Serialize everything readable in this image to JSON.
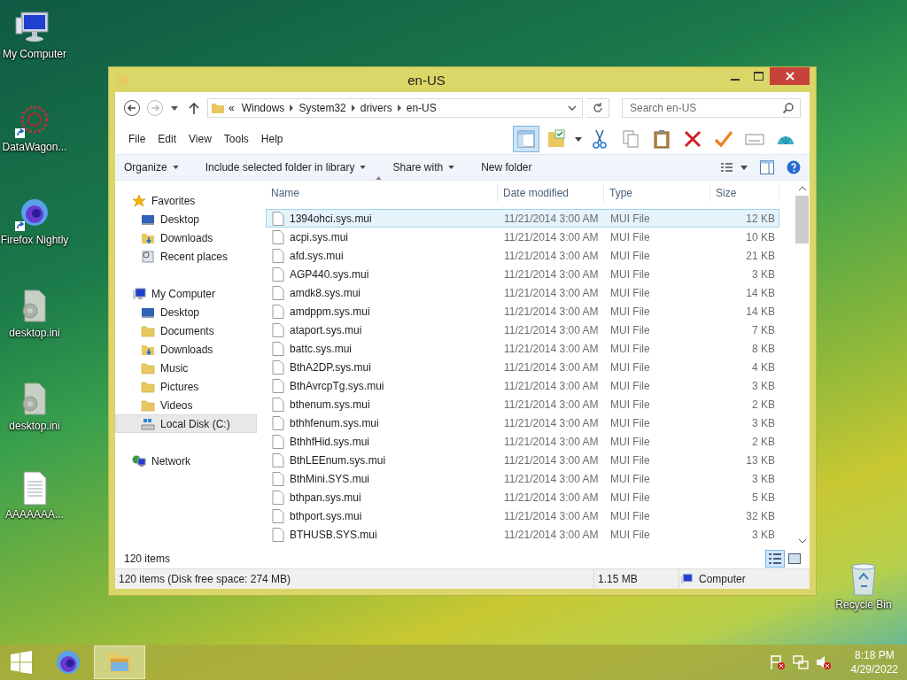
{
  "desktop_icons": [
    {
      "label": "My Computer",
      "kind": "computer",
      "shortcut": false
    },
    {
      "label": "DataWagon...",
      "kind": "wheel",
      "shortcut": true
    },
    {
      "label": "Firefox Nightly",
      "kind": "firefox",
      "shortcut": true
    },
    {
      "label": "desktop.ini",
      "kind": "ini",
      "shortcut": false
    },
    {
      "label": "desktop.ini",
      "kind": "ini",
      "shortcut": false
    },
    {
      "label": "AAAAAAA...",
      "kind": "text",
      "shortcut": false
    }
  ],
  "recycle_bin": {
    "label": "Recycle Bin"
  },
  "window": {
    "title": "en-US",
    "address": {
      "crumbs": [
        "«",
        "Windows",
        "System32",
        "drivers",
        "en-US"
      ]
    },
    "search": {
      "placeholder": "Search en-US"
    },
    "menu": [
      "File",
      "Edit",
      "View",
      "Tools",
      "Help"
    ],
    "toolbar": [
      {
        "kind": "layout",
        "on": true
      },
      {
        "kind": "folder-check",
        "on": false
      },
      {
        "kind": "cut",
        "on": false
      },
      {
        "kind": "copy",
        "on": false
      },
      {
        "kind": "paste",
        "on": false
      },
      {
        "kind": "delete",
        "on": false
      },
      {
        "kind": "check",
        "on": false
      },
      {
        "kind": "rename",
        "on": false
      },
      {
        "kind": "shell",
        "on": false
      }
    ],
    "commands": [
      {
        "label": "Organize",
        "has_menu": true
      },
      {
        "label": "Include selected folder in library",
        "has_menu": true
      },
      {
        "label": "Share with",
        "has_menu": true
      },
      {
        "label": "New folder",
        "has_menu": false
      }
    ],
    "nav": [
      {
        "label": "Favorites",
        "kind": "star",
        "selected": false,
        "children": [
          {
            "label": "Desktop",
            "kind": "desktop",
            "selected": false
          },
          {
            "label": "Downloads",
            "kind": "downloads",
            "selected": false
          },
          {
            "label": "Recent places",
            "kind": "recent",
            "selected": false
          }
        ]
      },
      {
        "label": "My Computer",
        "kind": "computer",
        "selected": false,
        "children": [
          {
            "label": "Desktop",
            "kind": "desktop",
            "selected": false
          },
          {
            "label": "Documents",
            "kind": "folder",
            "selected": false
          },
          {
            "label": "Downloads",
            "kind": "downloads",
            "selected": false
          },
          {
            "label": "Music",
            "kind": "folder",
            "selected": false
          },
          {
            "label": "Pictures",
            "kind": "folder",
            "selected": false
          },
          {
            "label": "Videos",
            "kind": "folder",
            "selected": false
          },
          {
            "label": "Local Disk (C:)",
            "kind": "disk",
            "selected": true
          }
        ]
      },
      {
        "label": "Network",
        "kind": "network",
        "selected": false
      }
    ],
    "columns": [
      "Name",
      "Date modified",
      "Type",
      "Size"
    ],
    "rows": [
      {
        "name": "1394ohci.sys.mui",
        "date": "11/21/2014 3:00 AM",
        "type": "MUI File",
        "size": "12 KB",
        "selected": true
      },
      {
        "name": "acpi.sys.mui",
        "date": "11/21/2014 3:00 AM",
        "type": "MUI File",
        "size": "10 KB",
        "selected": false
      },
      {
        "name": "afd.sys.mui",
        "date": "11/21/2014 3:00 AM",
        "type": "MUI File",
        "size": "21 KB",
        "selected": false
      },
      {
        "name": "AGP440.sys.mui",
        "date": "11/21/2014 3:00 AM",
        "type": "MUI File",
        "size": "3 KB",
        "selected": false
      },
      {
        "name": "amdk8.sys.mui",
        "date": "11/21/2014 3:00 AM",
        "type": "MUI File",
        "size": "14 KB",
        "selected": false
      },
      {
        "name": "amdppm.sys.mui",
        "date": "11/21/2014 3:00 AM",
        "type": "MUI File",
        "size": "14 KB",
        "selected": false
      },
      {
        "name": "ataport.sys.mui",
        "date": "11/21/2014 3:00 AM",
        "type": "MUI File",
        "size": "7 KB",
        "selected": false
      },
      {
        "name": "battc.sys.mui",
        "date": "11/21/2014 3:00 AM",
        "type": "MUI File",
        "size": "8 KB",
        "selected": false
      },
      {
        "name": "BthA2DP.sys.mui",
        "date": "11/21/2014 3:00 AM",
        "type": "MUI File",
        "size": "4 KB",
        "selected": false
      },
      {
        "name": "BthAvrcpTg.sys.mui",
        "date": "11/21/2014 3:00 AM",
        "type": "MUI File",
        "size": "3 KB",
        "selected": false
      },
      {
        "name": "bthenum.sys.mui",
        "date": "11/21/2014 3:00 AM",
        "type": "MUI File",
        "size": "2 KB",
        "selected": false
      },
      {
        "name": "bthhfenum.sys.mui",
        "date": "11/21/2014 3:00 AM",
        "type": "MUI File",
        "size": "3 KB",
        "selected": false
      },
      {
        "name": "BthhfHid.sys.mui",
        "date": "11/21/2014 3:00 AM",
        "type": "MUI File",
        "size": "2 KB",
        "selected": false
      },
      {
        "name": "BthLEEnum.sys.mui",
        "date": "11/21/2014 3:00 AM",
        "type": "MUI File",
        "size": "13 KB",
        "selected": false
      },
      {
        "name": "BthMini.SYS.mui",
        "date": "11/21/2014 3:00 AM",
        "type": "MUI File",
        "size": "3 KB",
        "selected": false
      },
      {
        "name": "bthpan.sys.mui",
        "date": "11/21/2014 3:00 AM",
        "type": "MUI File",
        "size": "5 KB",
        "selected": false
      },
      {
        "name": "bthport.sys.mui",
        "date": "11/21/2014 3:00 AM",
        "type": "MUI File",
        "size": "32 KB",
        "selected": false
      },
      {
        "name": "BTHUSB.SYS.mui",
        "date": "11/21/2014 3:00 AM",
        "type": "MUI File",
        "size": "3 KB",
        "selected": false
      }
    ],
    "item_count": "120 items",
    "views": [
      {
        "kind": "details",
        "selected": true
      },
      {
        "kind": "large-icons",
        "selected": false
      }
    ],
    "status_bar": [
      "120 items (Disk free space: 274 MB)",
      "1.15 MB",
      "Computer"
    ]
  },
  "taskbar": {
    "apps": [
      {
        "kind": "firefox",
        "selected": false
      },
      {
        "kind": "explorer",
        "selected": true
      }
    ],
    "tray": [
      {
        "kind": "flag"
      },
      {
        "kind": "network"
      },
      {
        "kind": "speaker"
      }
    ],
    "time": "8:18 PM",
    "date": "4/29/2022"
  }
}
